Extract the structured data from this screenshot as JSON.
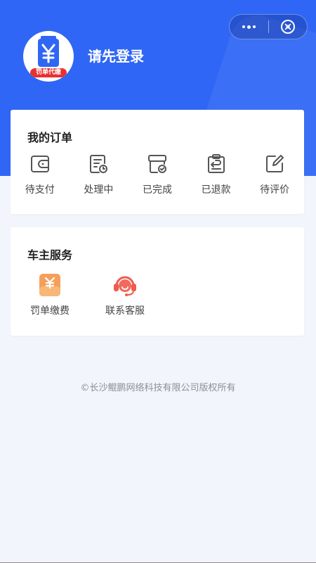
{
  "header": {
    "login_prompt": "请先登录",
    "avatar_badge": "罚单代缴",
    "avatar_symbol": "¥",
    "accent_color": "#2f66f5"
  },
  "capsule": {
    "more_icon": "more-dots-icon",
    "close_icon": "close-circle-icon"
  },
  "orders": {
    "title": "我的订单",
    "items": [
      {
        "label": "待支付",
        "icon": "wallet-icon"
      },
      {
        "label": "处理中",
        "icon": "document-clock-icon"
      },
      {
        "label": "已完成",
        "icon": "box-check-icon"
      },
      {
        "label": "已退款",
        "icon": "clipboard-return-icon"
      },
      {
        "label": "待评价",
        "icon": "edit-icon"
      }
    ]
  },
  "services": {
    "title": "车主服务",
    "items": [
      {
        "label": "罚单缴费",
        "icon": "fine-payment-icon"
      },
      {
        "label": "联系客服",
        "icon": "customer-service-icon"
      }
    ]
  },
  "footer": {
    "copyright": "©长沙鲲鹏网络科技有限公司版权所有"
  }
}
